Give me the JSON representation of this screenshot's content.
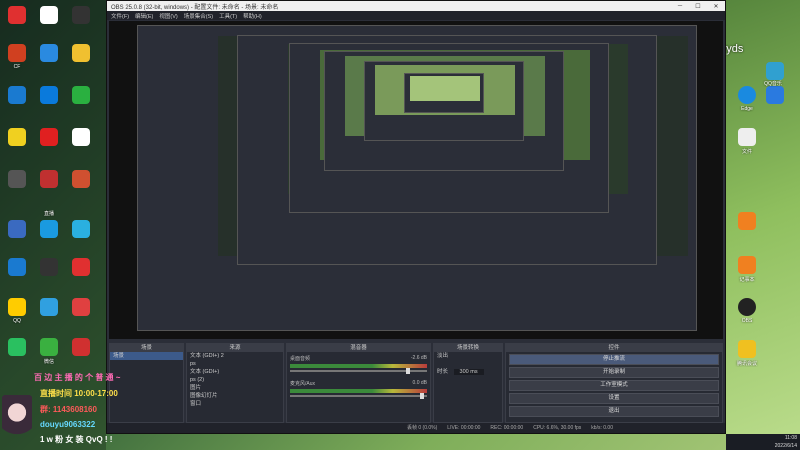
{
  "window": {
    "title": "OBS 25.0.8 (32-bit, windows) - 配置文件: 未命名 - 场景: 未命名",
    "menu": [
      "文件(F)",
      "编辑(E)",
      "视图(V)",
      "场景集合(S)",
      "工具(T)",
      "帮助(H)"
    ]
  },
  "docks": {
    "scenes": {
      "title": "场景",
      "items": [
        "场景"
      ]
    },
    "sources": {
      "title": "来源",
      "items": [
        "文本 (GDI+) 2",
        "ps",
        "文本 (GDI+)",
        "ps (2)",
        "图片",
        "图像幻灯片",
        "窗口"
      ]
    },
    "mixer": {
      "title": "混音器",
      "channels": [
        {
          "name": "桌面音频",
          "db": "-2.6 dB"
        },
        {
          "name": "麦克风/Aux",
          "db": "0.0 dB"
        }
      ]
    },
    "transitions": {
      "title": "场景转换",
      "type": "淡出",
      "duration_label": "时长",
      "duration": "300 ms"
    },
    "controls": {
      "title": "控件",
      "buttons": [
        "停止推流",
        "开始录制",
        "工作室模式",
        "设置",
        "退出"
      ]
    }
  },
  "status": {
    "live": "LIVE: 00:00:00",
    "rec": "REC: 00:00:00",
    "cpu": "CPU: 6.6%, 30.00 fps",
    "dropped": "丢帧 0 (0.0%)",
    "kbps": "kb/s: 0.00"
  },
  "overlay": {
    "line1": "百 边 主 播 的 个 普 通 ~",
    "line2": "直播时间 10:00-17:00",
    "line3": "群: 1143608160",
    "line4": "douyu9063322",
    "line5": "1 w 粉 女 装 QvQ ! !"
  },
  "watermark": "小F yyds",
  "taskbar": {
    "time": "11:08",
    "date": "2022/6/14"
  },
  "desktop_left_labels": [
    "CF",
    "QQ",
    "钉钉",
    "微信",
    "直播"
  ],
  "desktop_right_labels": [
    "QQ音乐",
    "Edge",
    "文件",
    "记事本",
    "OBS",
    "腾讯会议"
  ]
}
